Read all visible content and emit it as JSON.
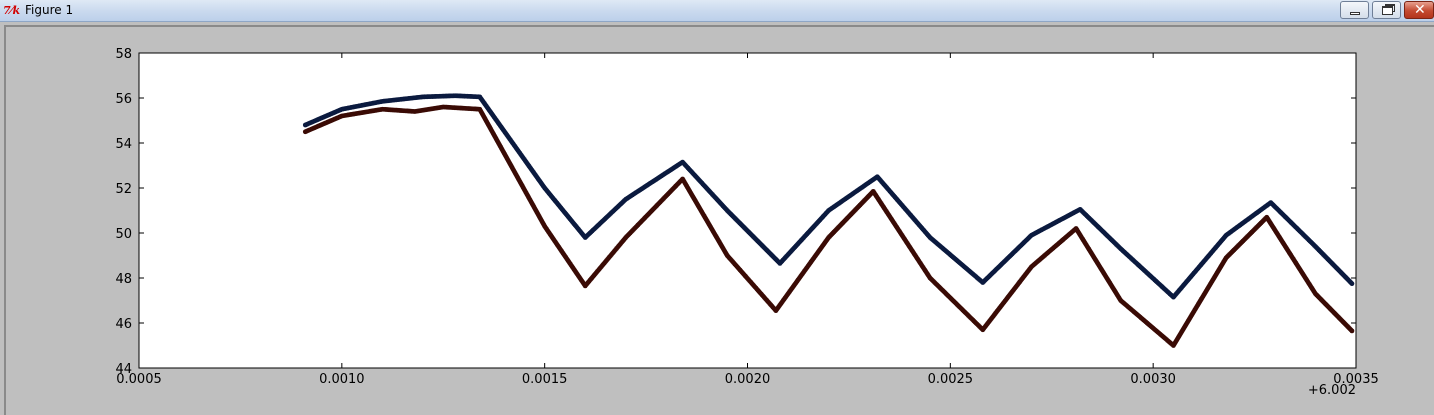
{
  "window": {
    "title": "Figure 1",
    "icon": "tk-feather-icon",
    "controls": [
      "minimize-icon",
      "restore-icon",
      "close-icon"
    ]
  },
  "chart_data": {
    "type": "scatter",
    "title": "",
    "xlabel": "",
    "ylabel": "",
    "x_offset_label": "+6.002",
    "xlim": [
      0.0005,
      0.0035
    ],
    "ylim": [
      44,
      58
    ],
    "x_ticks": [
      0.0005,
      0.001,
      0.0015,
      0.002,
      0.0025,
      0.003,
      0.0035
    ],
    "x_tick_labels": [
      "0.0005",
      "0.0010",
      "0.0015",
      "0.0020",
      "0.0025",
      "0.0030",
      "0.0035"
    ],
    "y_ticks": [
      44,
      46,
      48,
      50,
      52,
      54,
      56,
      58
    ],
    "y_tick_labels": [
      "44",
      "46",
      "48",
      "50",
      "52",
      "54",
      "56",
      "58"
    ],
    "grid": false,
    "legend": "none",
    "series": [
      {
        "color": "#0b1a3f",
        "points": [
          [
            0.00091,
            54.8
          ],
          [
            0.001,
            55.5
          ],
          [
            0.0011,
            55.85
          ],
          [
            0.0012,
            56.05
          ],
          [
            0.00128,
            56.1
          ],
          [
            0.00134,
            56.05
          ],
          [
            0.0015,
            52.0
          ],
          [
            0.0016,
            49.8
          ],
          [
            0.0017,
            51.5
          ],
          [
            0.00184,
            53.15
          ],
          [
            0.00195,
            51.0
          ],
          [
            0.00208,
            48.65
          ],
          [
            0.0022,
            51.0
          ],
          [
            0.00232,
            52.5
          ],
          [
            0.00245,
            49.8
          ],
          [
            0.00258,
            47.8
          ],
          [
            0.0027,
            49.9
          ],
          [
            0.00282,
            51.05
          ],
          [
            0.00292,
            49.3
          ],
          [
            0.00305,
            47.15
          ],
          [
            0.00318,
            49.9
          ],
          [
            0.00329,
            51.35
          ],
          [
            0.0034,
            49.4
          ],
          [
            0.00349,
            47.75
          ]
        ]
      },
      {
        "color": "#3a0b05",
        "points": [
          [
            0.00091,
            54.5
          ],
          [
            0.001,
            55.2
          ],
          [
            0.0011,
            55.5
          ],
          [
            0.00118,
            55.4
          ],
          [
            0.00125,
            55.6
          ],
          [
            0.00134,
            55.5
          ],
          [
            0.0015,
            50.3
          ],
          [
            0.0016,
            47.65
          ],
          [
            0.0017,
            49.8
          ],
          [
            0.00184,
            52.4
          ],
          [
            0.00195,
            49.0
          ],
          [
            0.00207,
            46.55
          ],
          [
            0.0022,
            49.8
          ],
          [
            0.00231,
            51.85
          ],
          [
            0.00245,
            48.0
          ],
          [
            0.00258,
            45.7
          ],
          [
            0.0027,
            48.5
          ],
          [
            0.00281,
            50.2
          ],
          [
            0.00292,
            47.0
          ],
          [
            0.00305,
            45.0
          ],
          [
            0.00318,
            48.9
          ],
          [
            0.00328,
            50.7
          ],
          [
            0.0034,
            47.3
          ],
          [
            0.00349,
            45.65
          ]
        ]
      }
    ]
  }
}
